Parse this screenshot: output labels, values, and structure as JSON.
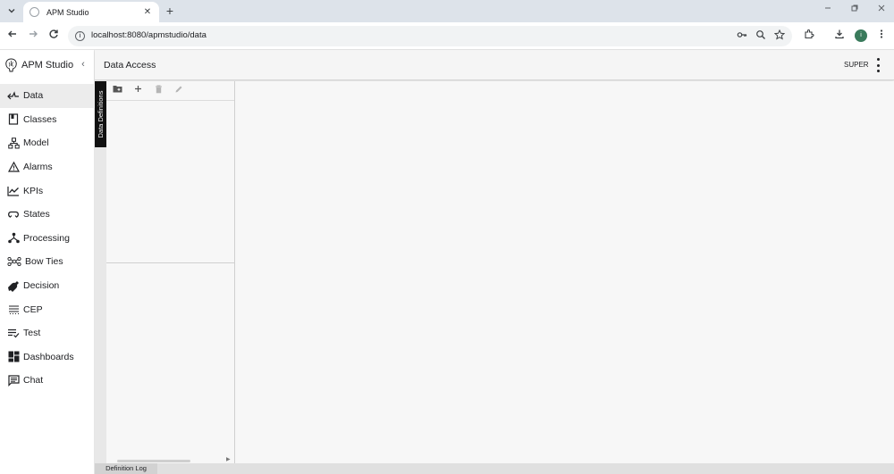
{
  "browser": {
    "tab_title": "APM Studio",
    "tab_close": "✕",
    "new_tab": "+",
    "url": "localhost:8080/apmstudio/data",
    "profile_initial": "i",
    "window_controls": [
      "minimize-icon",
      "restore-icon",
      "close-icon"
    ]
  },
  "app": {
    "brand": "APM Studio",
    "collapse_glyph": "‹",
    "page_title": "Data Access",
    "user": "SUPER"
  },
  "sidebar": {
    "items": [
      {
        "label": "Data",
        "icon": "data-icon",
        "active": true
      },
      {
        "label": "Classes",
        "icon": "classes-icon"
      },
      {
        "label": "Model",
        "icon": "model-icon"
      },
      {
        "label": "Alarms",
        "icon": "alarms-icon"
      },
      {
        "label": "KPIs",
        "icon": "kpis-icon"
      },
      {
        "label": "States",
        "icon": "states-icon"
      },
      {
        "label": "Processing",
        "icon": "processing-icon"
      },
      {
        "label": "Bow Ties",
        "icon": "bow-ties-icon"
      },
      {
        "label": "Decision",
        "icon": "decision-icon"
      },
      {
        "label": "CEP",
        "icon": "cep-icon"
      },
      {
        "label": "Test",
        "icon": "test-icon"
      },
      {
        "label": "Dashboards",
        "icon": "dashboards-icon"
      },
      {
        "label": "Chat",
        "icon": "chat-icon"
      }
    ]
  },
  "panel": {
    "vertical_tab": "Data Definitions",
    "toolbar_icons": [
      "new-folder-icon",
      "add-icon",
      "delete-icon",
      "edit-icon"
    ]
  },
  "bottom": {
    "tab": "Definition Log"
  },
  "colors": {
    "active_nav_bg": "#ececec",
    "vertical_tab_bg": "#111111",
    "avatar_bg": "#3a7b5c"
  }
}
